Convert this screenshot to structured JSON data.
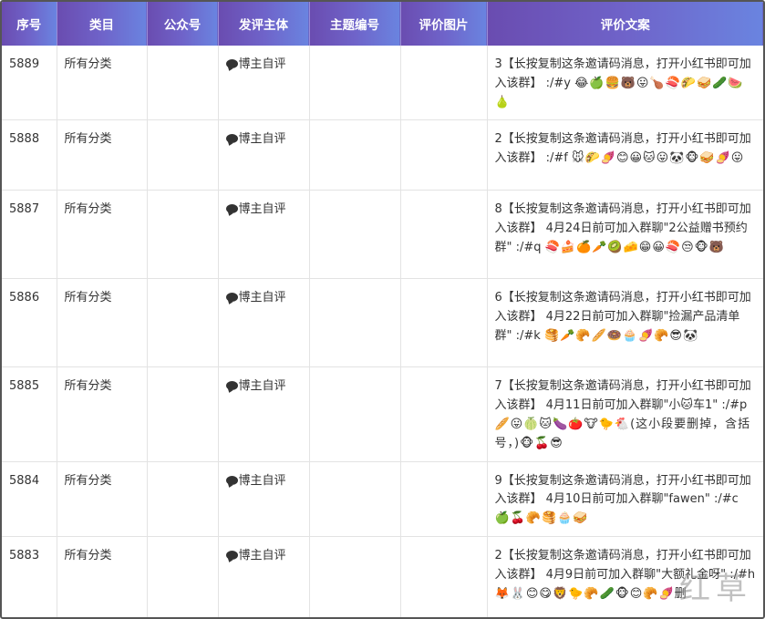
{
  "columns": [
    "序号",
    "类目",
    "公众号",
    "发评主体",
    "主题编号",
    "评价图片",
    "评价文案"
  ],
  "rows": [
    {
      "id": "5889",
      "category": "所有分类",
      "account": "",
      "subject": "博主自评",
      "topic": "",
      "image": "",
      "copy": "3【长按复制这条邀请码消息，打开小红书即可加入该群】 :/#y",
      "emojis": "😂🍏🍔🐻😛🍗🍣🌮🥪🥒🍉🍐"
    },
    {
      "id": "5888",
      "category": "所有分类",
      "account": "",
      "subject": "博主自评",
      "topic": "",
      "image": "",
      "copy": "2【长按复制这条邀请码消息，打开小红书即可加入该群】 :/#f",
      "emojis": "🐭🌮🍠😊😀🐱😛🐼🐵🥪🍠😛"
    },
    {
      "id": "5887",
      "category": "所有分类",
      "account": "",
      "subject": "博主自评",
      "topic": "",
      "image": "",
      "copy": "8【长按复制这条邀请码消息，打开小红书即可加入该群】 4月24日前可加入群聊\"2公益赠书预约群\" :/#q",
      "emojis": "🍣🍰🍊🥕🥝🧀😁😀🍣😒🐵🐻"
    },
    {
      "id": "5886",
      "category": "所有分类",
      "account": "",
      "subject": "博主自评",
      "topic": "",
      "image": "",
      "copy": "6【长按复制这条邀请码消息，打开小红书即可加入该群】 4月22日前可加入群聊\"捡漏产品清单群\" :/#k",
      "emojis": "🥞🥕🥐🥖🍩🧁🍠🥐😎🐼"
    },
    {
      "id": "5885",
      "category": "所有分类",
      "account": "",
      "subject": "博主自评",
      "topic": "",
      "image": "",
      "copy": "7【长按复制这条邀请码消息，打开小红书即可加入该群】 4月11日前可加入群聊\"小🐱车1\" :/#p",
      "emojis": "🥖😛🍈🐱🍆🍅🐮🐤🐔(这小段要删掉，含括号，)🐵🍒😎"
    },
    {
      "id": "5884",
      "category": "所有分类",
      "account": "",
      "subject": "博主自评",
      "topic": "",
      "image": "",
      "copy": "9【长按复制这条邀请码消息，打开小红书即可加入该群】 4月10日前可加入群聊\"fawen\" :/#c",
      "emojis": "🍏🍒🥐🥞🧁🥪"
    },
    {
      "id": "5883",
      "category": "所有分类",
      "account": "",
      "subject": "博主自评",
      "topic": "",
      "image": "",
      "copy": "2【长按复制这条邀请码消息，打开小红书即可加入该群】 4月9日前可加入群聊\"大额礼金呀\" :/#h",
      "emojis": "🦊🐰😊😋🦁🐤🥐🥒🐵😊🥐🍠删"
    }
  ],
  "watermark": "红草",
  "icons": {
    "subject_icon": "speech-bubble-icon"
  }
}
